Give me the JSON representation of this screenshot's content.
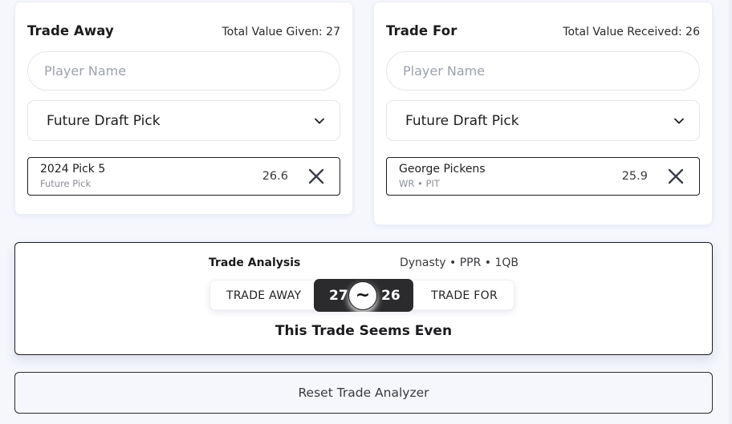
{
  "trade_away": {
    "title": "Trade Away",
    "total_label": "Total Value Given: 27",
    "player_input": {
      "placeholder": "Player Name",
      "value": ""
    },
    "pick_select": {
      "selected": "Future Draft Pick",
      "icon": "chevron-down-icon"
    },
    "assets": [
      {
        "name": "2024 Pick 5",
        "subtitle": "Future Pick",
        "value": "26.6",
        "remove_icon": "close-icon"
      }
    ]
  },
  "trade_for": {
    "title": "Trade For",
    "total_label": "Total Value Received: 26",
    "player_input": {
      "placeholder": "Player Name",
      "value": ""
    },
    "pick_select": {
      "selected": "Future Draft Pick",
      "icon": "chevron-down-icon"
    },
    "assets": [
      {
        "name": "George Pickens",
        "subtitle": "WR • PIT",
        "value": "25.9",
        "remove_icon": "close-icon"
      }
    ]
  },
  "analysis": {
    "title": "Trade Analysis",
    "settings": "Dynasty • PPR • 1QB",
    "meter": {
      "away_label": "TRADE AWAY",
      "for_label": "TRADE FOR",
      "away_value": "27",
      "for_value": "26",
      "center_symbol": "~"
    },
    "verdict": "This Trade Seems Even"
  },
  "reset_button": {
    "label": "Reset Trade Analyzer"
  },
  "colors": {
    "background": "#f5f7fd",
    "card": "#ffffff",
    "dark_accent": "#2b2b2d",
    "border_dark": "#1c1c1f",
    "muted_text": "#8a8e96"
  }
}
